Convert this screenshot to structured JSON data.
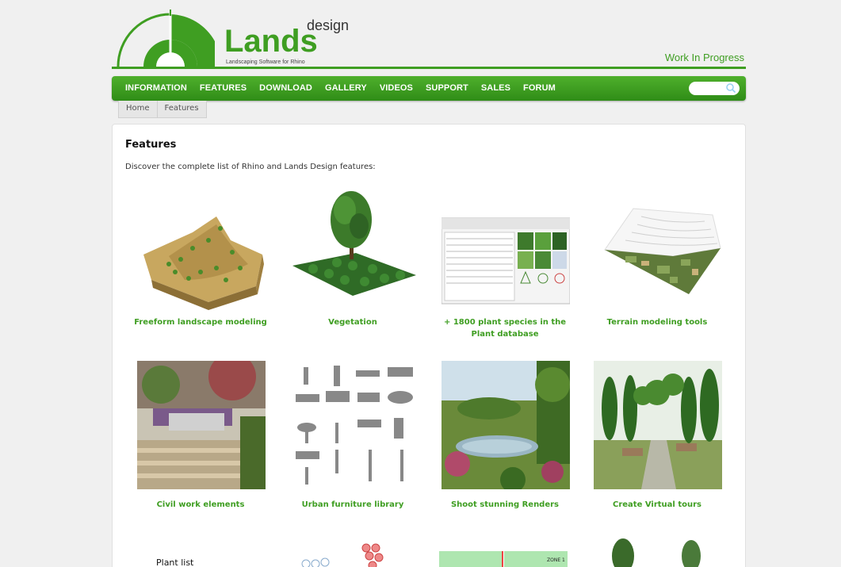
{
  "header": {
    "logo_main": "Lands",
    "logo_super": "design",
    "logo_tagline": "Landscaping Software for Rhino",
    "status": "Work In Progress"
  },
  "nav": {
    "items": [
      {
        "label": "INFORMATION"
      },
      {
        "label": "FEATURES"
      },
      {
        "label": "DOWNLOAD"
      },
      {
        "label": "GALLERY"
      },
      {
        "label": "VIDEOS"
      },
      {
        "label": "SUPPORT"
      },
      {
        "label": "SALES"
      },
      {
        "label": "FORUM"
      }
    ],
    "search_placeholder": ""
  },
  "breadcrumb": [
    "Home",
    "Features"
  ],
  "main": {
    "title": "Features",
    "intro": "Discover the complete list of Rhino and Lands Design features:",
    "features": [
      {
        "label_line1": "Freeform landscape modeling",
        "label_line2": "",
        "thumb": "freeform-terrain-image"
      },
      {
        "label_line1": "Vegetation",
        "label_line2": "",
        "thumb": "vegetation-tree-image"
      },
      {
        "label_line1": "+ 1800 plant species in the",
        "label_line2": "Plant database",
        "thumb": "plant-database-screenshot"
      },
      {
        "label_line1": "Terrain modeling tools",
        "label_line2": "",
        "thumb": "terrain-tools-image"
      },
      {
        "label_line1": "Civil work elements",
        "label_line2": "",
        "thumb": "civil-work-render"
      },
      {
        "label_line1": "Urban furniture library",
        "label_line2": "",
        "thumb": "urban-furniture-grid"
      },
      {
        "label_line1": "Shoot stunning Renders",
        "label_line2": "",
        "thumb": "render-pond-image"
      },
      {
        "label_line1": "Create Virtual tours",
        "label_line2": "",
        "thumb": "virtual-tour-garden"
      }
    ],
    "partial_row": {
      "plant_list_label": "Plant list",
      "zone_label": "ZONE 1"
    }
  },
  "colors": {
    "brand_green": "#3f9e22",
    "nav_green_top": "#4fb02c",
    "nav_green_bottom": "#2f8c17"
  }
}
